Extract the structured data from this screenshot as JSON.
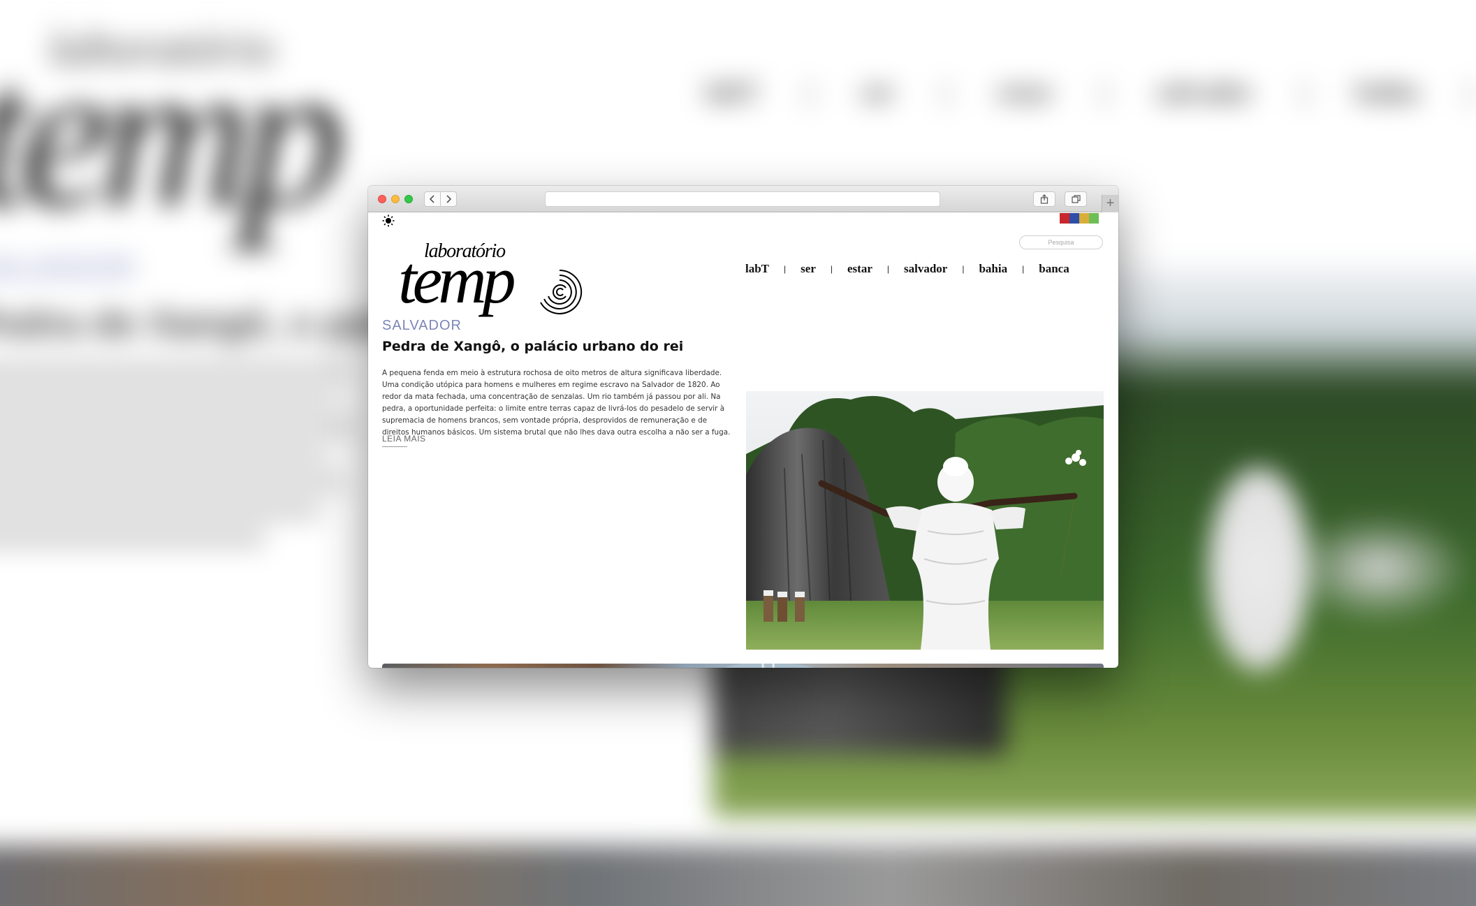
{
  "background": {
    "logo_small": "laboratório",
    "logo_main": "temp",
    "section": "SALVADOR",
    "title": "Pedra de Xangô, o palácio urbano do rei",
    "nav": "labT | ser | estar | salvador | bahia | banca"
  },
  "browser": {
    "address_value": "",
    "back_icon": "chevron-left-icon",
    "forward_icon": "chevron-right-icon",
    "share_icon": "share-icon",
    "tabs_icon": "tabs-icon",
    "newtab_label": "+"
  },
  "site": {
    "theme_icon": "sun-icon",
    "color_bars": [
      "#c8282d",
      "#2f4fa6",
      "#d8ae3a",
      "#6fbe55"
    ],
    "search": {
      "placeholder": "Pesquisa"
    },
    "logo": {
      "sub": "laboratório",
      "main": "temp"
    },
    "nav": [
      {
        "label": "labT"
      },
      {
        "label": "ser"
      },
      {
        "label": "estar"
      },
      {
        "label": "salvador"
      },
      {
        "label": "bahia"
      },
      {
        "label": "banca"
      }
    ],
    "nav_separator": "|"
  },
  "article": {
    "section": "SALVADOR",
    "title": "Pedra de Xangô, o palácio urbano do rei",
    "text": "A pequena fenda em meio à estrutura rochosa de oito metros de altura significava liberdade. Uma condição utópica para homens e mulheres em regime escravo na Salvador de 1820. Ao redor da mata fechada, uma concentração de senzalas. Um rio também já passou por ali. Na pedra, a oportunidade perfeita: o limite entre terras capaz de livrá-los do pesadelo de servir à supremacia de homens brancos, sem vontade própria, desprovidos de remuneração e de direitos humanos básicos. Um sistema brutal que não lhes dava outra escolha a não ser a fuga.",
    "read_more": "LEIA MAIS"
  }
}
